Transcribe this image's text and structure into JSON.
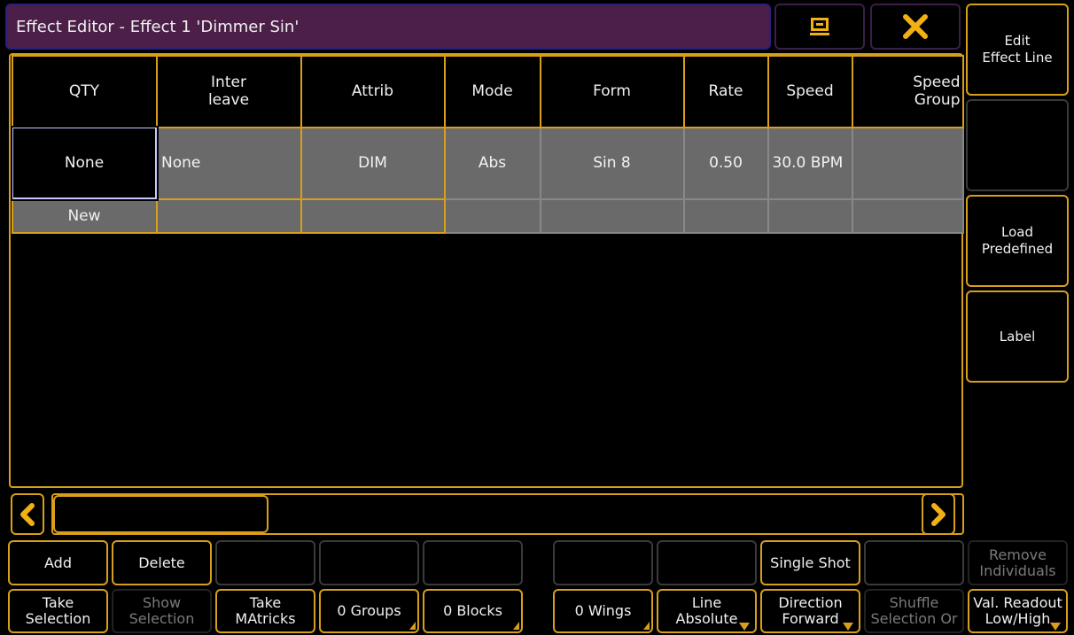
{
  "window": {
    "title": "Effect Editor - Effect 1 'Dimmer Sin'"
  },
  "toolbar": {
    "screen_icon": "screen-icon",
    "close_icon": "close-icon"
  },
  "side_buttons": [
    {
      "label": "Edit\nEffect Line",
      "name": "edit-effect-line-button"
    },
    {
      "label": "",
      "name": "side-empty-button"
    },
    {
      "label": "Load\nPredefined",
      "name": "load-predefined-button"
    },
    {
      "label": "Label",
      "name": "label-button"
    }
  ],
  "grid": {
    "headers": [
      "QTY",
      "Inter\nleave",
      "Attrib",
      "Mode",
      "Form",
      "Rate",
      "Speed",
      "Speed\nGroup"
    ],
    "row1": [
      "None",
      "None",
      "DIM",
      "Abs",
      "Sin 8",
      "0.50",
      "30.0 BPM",
      ""
    ],
    "row2": [
      "New",
      "",
      "",
      "",
      "",
      "",
      "",
      ""
    ]
  },
  "bottom_row1": [
    {
      "label": "Add",
      "state": "normal"
    },
    {
      "label": "Delete",
      "state": "normal"
    },
    {
      "label": "",
      "state": "empty"
    },
    {
      "label": "",
      "state": "empty"
    },
    {
      "label": "",
      "state": "empty"
    },
    {
      "label": "",
      "state": "empty"
    },
    {
      "label": "",
      "state": "empty"
    },
    {
      "label": "Single Shot",
      "state": "normal"
    },
    {
      "label": "",
      "state": "empty"
    },
    {
      "label": "Remove\nIndividuals",
      "state": "disabled"
    }
  ],
  "bottom_row2": [
    {
      "label": "Take\nSelection",
      "state": "normal"
    },
    {
      "label": "Show\nSelection",
      "state": "disabled"
    },
    {
      "label": "Take\nMAtricks",
      "state": "normal"
    },
    {
      "label": "0 Groups",
      "state": "normal"
    },
    {
      "label": "0 Blocks",
      "state": "normal"
    },
    {
      "label": "0 Wings",
      "state": "normal"
    },
    {
      "label": "Line\nAbsolute",
      "state": "normal"
    },
    {
      "label": "Direction\nForward",
      "state": "normal"
    },
    {
      "label": "Shuffle\nSelection Or",
      "state": "disabled"
    },
    {
      "label": "Val. Readout\nLow/High",
      "state": "normal"
    }
  ],
  "colors": {
    "accent": "#d79f1a",
    "title_bg": "#4b1f48",
    "cell_bg": "#6a6a6a",
    "close_x": "#f2b014"
  }
}
